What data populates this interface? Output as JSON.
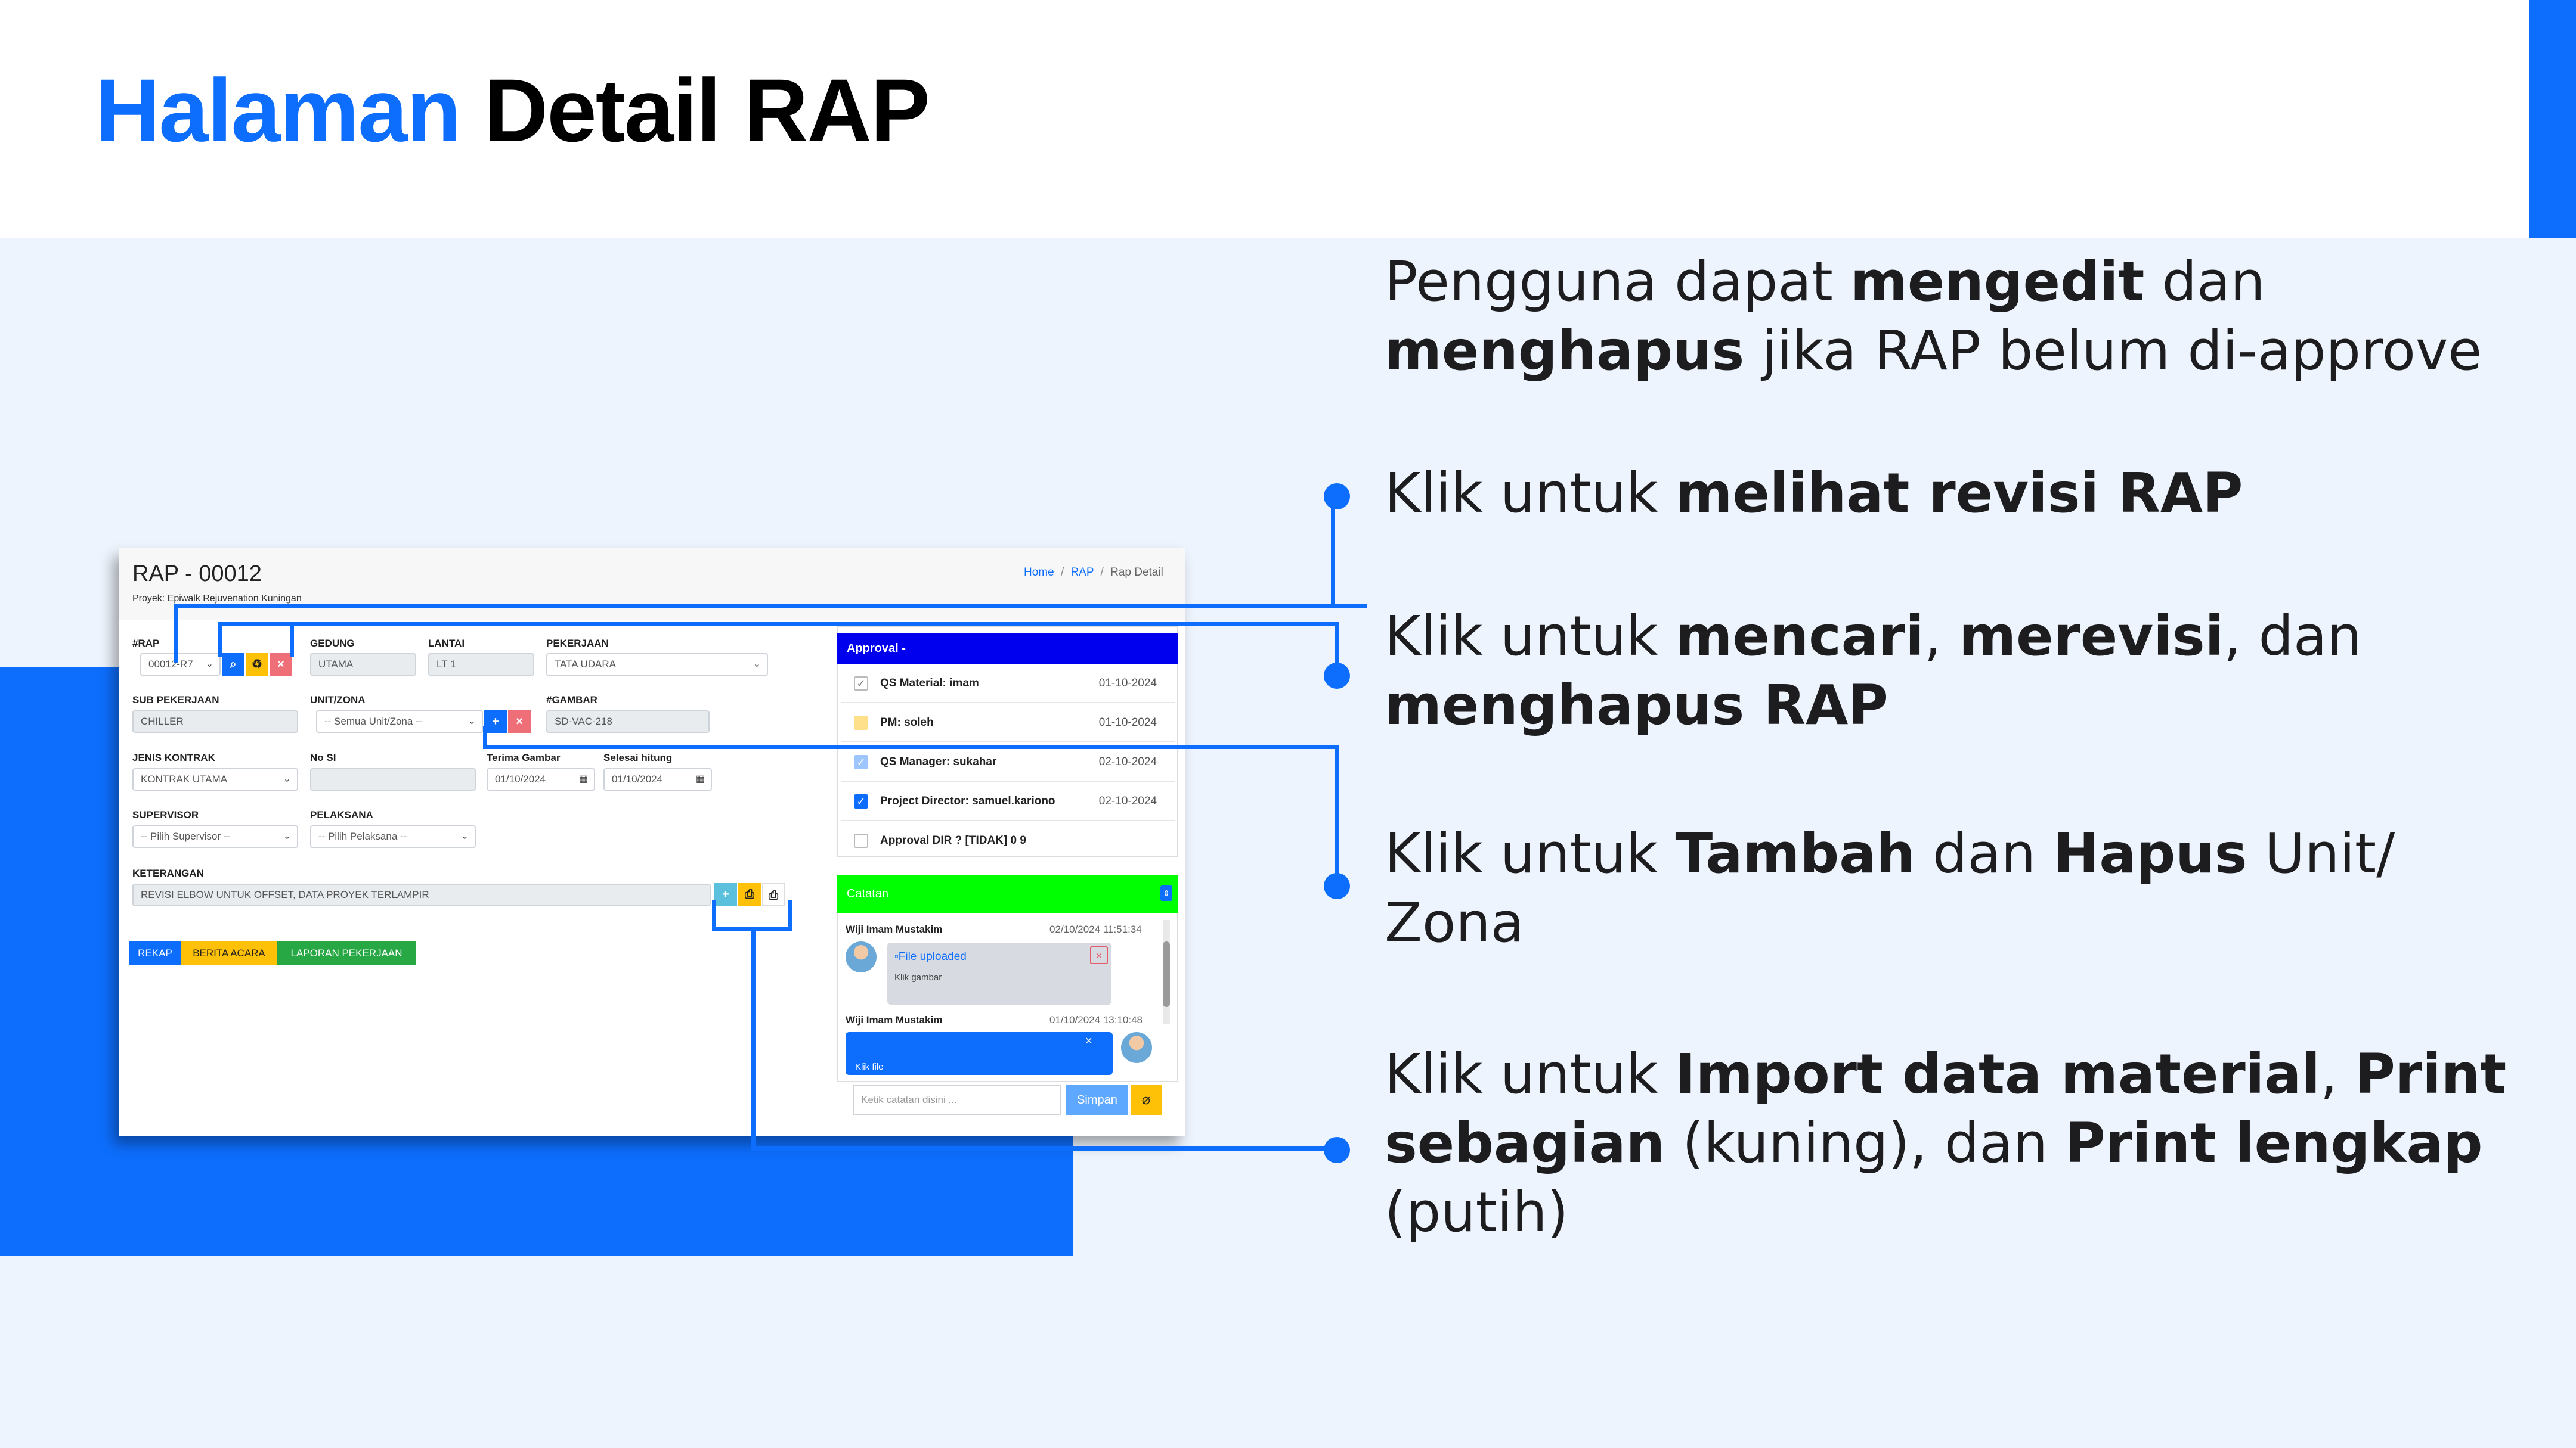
{
  "slide": {
    "title_accent": "Halaman",
    "title_rest": "Detail RAP",
    "brand_color": "#0d6efd"
  },
  "callouts": [
    {
      "parts": [
        {
          "t": "Pengguna dapat ",
          "b": false
        },
        {
          "t": "mengedit",
          "b": true
        },
        {
          "t": " dan",
          "b": false
        },
        {
          "br": true
        },
        {
          "t": "menghapus",
          "b": true
        },
        {
          "t": " jika RAP belum di-approve",
          "b": false
        }
      ]
    },
    {
      "parts": [
        {
          "t": "Klik untuk ",
          "b": false
        },
        {
          "t": "melihat revisi RAP",
          "b": true
        }
      ]
    },
    {
      "parts": [
        {
          "t": "Klik untuk ",
          "b": false
        },
        {
          "t": "mencari",
          "b": true
        },
        {
          "t": ", ",
          "b": false
        },
        {
          "t": "merevisi",
          "b": true
        },
        {
          "t": ", dan",
          "b": false
        },
        {
          "br": true
        },
        {
          "t": "menghapus RAP",
          "b": true
        }
      ]
    },
    {
      "parts": [
        {
          "t": "Klik untuk ",
          "b": false
        },
        {
          "t": "Tambah",
          "b": true
        },
        {
          "t": " dan ",
          "b": false
        },
        {
          "t": "Hapus",
          "b": true
        },
        {
          "t": " Unit/",
          "b": false
        },
        {
          "br": true
        },
        {
          "t": "Zona",
          "b": false
        }
      ]
    },
    {
      "parts": [
        {
          "t": "Klik untuk ",
          "b": false
        },
        {
          "t": "Import data material",
          "b": true
        },
        {
          "t": ", ",
          "b": false
        },
        {
          "t": "Print",
          "b": true
        },
        {
          "br": true
        },
        {
          "t": "sebagian",
          "b": true
        },
        {
          "t": " (kuning), dan ",
          "b": false
        },
        {
          "t": "Print lengkap",
          "b": true
        },
        {
          "br": true
        },
        {
          "t": "(putih)",
          "b": false
        }
      ]
    }
  ],
  "app": {
    "title": "RAP - 00012",
    "project": "Proyek: Epiwalk Rejuvenation Kuningan",
    "breadcrumb": {
      "home": "Home",
      "rap": "RAP",
      "current": "Rap Detail",
      "sep": "/"
    },
    "labels": {
      "rap": "#RAP",
      "gedung": "GEDUNG",
      "lantai": "LANTAI",
      "pekerjaan": "PEKERJAAN",
      "sub_pekerjaan": "SUB PEKERJAAN",
      "unit_zona": "UNIT/ZONA",
      "gambar": "#GAMBAR",
      "jenis_kontrak": "JENIS KONTRAK",
      "no_si": "No SI",
      "terima_gambar": "Terima Gambar",
      "selesai_hitung": "Selesai hitung",
      "supervisor": "SUPERVISOR",
      "pelaksana": "PELAKSANA",
      "keterangan": "KETERANGAN"
    },
    "values": {
      "rap": "00012-R7",
      "gedung": "UTAMA",
      "lantai": "LT 1",
      "pekerjaan": "TATA UDARA",
      "sub_pekerjaan": "CHILLER",
      "unit_zona": "-- Semua Unit/Zona --",
      "gambar": "SD-VAC-218",
      "jenis_kontrak": "KONTRAK UTAMA",
      "no_si": "",
      "terima_gambar": "01/10/2024",
      "selesai_hitung": "01/10/2024",
      "supervisor": "-- Pilih Supervisor --",
      "pelaksana": "-- Pilih Pelaksana --",
      "keterangan": "REVISI ELBOW UNTUK OFFSET, DATA PROYEK TERLAMPIR"
    },
    "tabs": {
      "rekap": "REKAP",
      "berita_acara": "BERITA ACARA",
      "laporan": "LAPORAN PEKERJAAN"
    },
    "approval": {
      "header": "Approval -",
      "rows": [
        {
          "name": "QS Material: imam",
          "date": "01-10-2024",
          "state": "checked-grey"
        },
        {
          "name": "PM: soleh",
          "date": "01-10-2024",
          "state": "yellow"
        },
        {
          "name": "QS Manager: sukahar",
          "date": "02-10-2024",
          "state": "checked-light"
        },
        {
          "name": "Project Director: samuel.kariono",
          "date": "02-10-2024",
          "state": "checked-blue"
        },
        {
          "name": "Approval DIR ? [TIDAK] 0 9",
          "date": "",
          "state": "empty"
        }
      ]
    },
    "catatan": {
      "header": "Catatan",
      "msg1": {
        "user": "Wiji Imam Mustakim",
        "time": "02/10/2024 11:51:34",
        "file": "File uploaded",
        "hint": "Klik gambar"
      },
      "msg2": {
        "user": "Wiji Imam Mustakim",
        "time": "01/10/2024 13:10:48",
        "hint": "Klik file"
      },
      "placeholder": "Ketik catatan disini ...",
      "save": "Simpan"
    }
  }
}
